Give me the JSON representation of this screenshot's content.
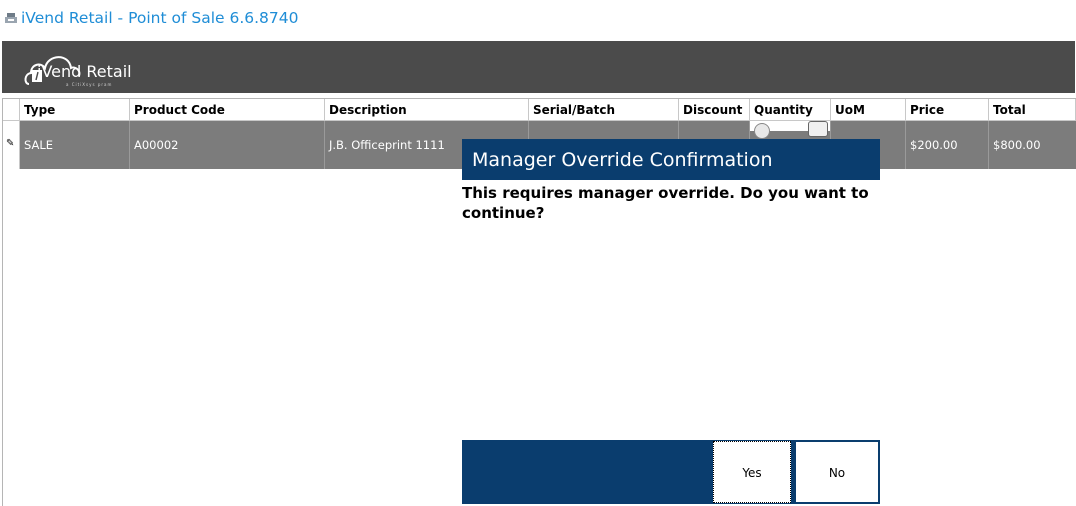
{
  "window": {
    "title": "iVend Retail - Point of Sale 6.6.8740",
    "icon": "pos-app-icon"
  },
  "header": {
    "brand": "iVend Retail",
    "brand_sub": "a CitiXsys pram",
    "logo_icon": "cloud-logo-icon",
    "background_color": "#4b4b4b"
  },
  "grid": {
    "columns": [
      "Type",
      "Product Code",
      "Description",
      "Serial/Batch",
      "Discount",
      "Quantity",
      "UoM",
      "Price",
      "Total"
    ],
    "rows": [
      {
        "type": "SALE",
        "product_code": "A00002",
        "description": "J.B. Officeprint 1111",
        "serial_batch": "",
        "discount": "",
        "quantity": "",
        "uom": "",
        "price": "$200.00",
        "total": "$800.00"
      }
    ],
    "row_indicator_icon": "pencil-edit-icon",
    "selected_row_color": "#7c7c7c"
  },
  "dialog": {
    "title": "Manager Override Confirmation",
    "message": "This requires manager override. Do you want to continue?",
    "yes_label": "Yes",
    "no_label": "No",
    "accent_color": "#0a3d6e"
  }
}
